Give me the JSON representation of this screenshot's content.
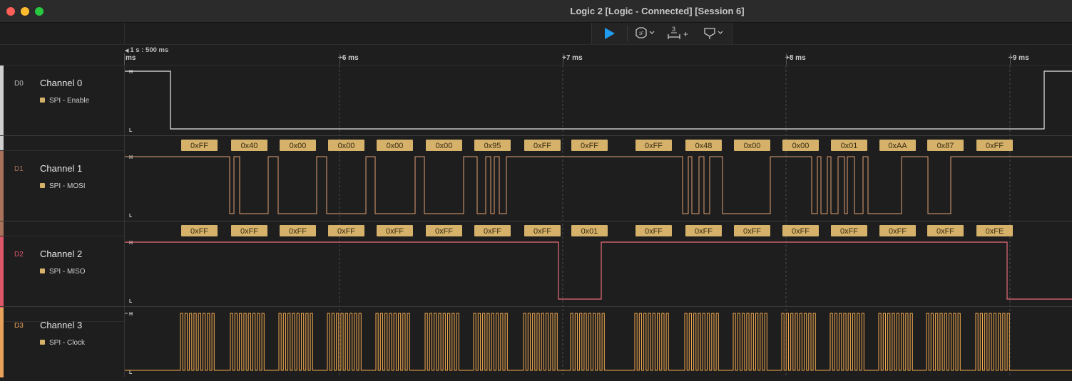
{
  "window": {
    "title": "Logic 2 [Logic - Connected] [Session 6]"
  },
  "toolbar": {
    "play_icon": "play-icon",
    "trigger_icon": "trigger-icon",
    "measure_label": "3",
    "measure_plus": "+",
    "marker_icon": "marker-icon"
  },
  "ruler": {
    "scale": "1 s : 500 ms",
    "unit": "ms",
    "ticks": [
      "+6 ms",
      "+7 ms",
      "+8 ms",
      "+9 ms"
    ]
  },
  "channels": [
    {
      "id": "D0",
      "name": "Channel 0",
      "analyzer": "SPI - Enable",
      "color": "#cfcfcf"
    },
    {
      "id": "D1",
      "name": "Channel 1",
      "analyzer": "SPI - MOSI",
      "color": "#a8735a"
    },
    {
      "id": "D2",
      "name": "Channel 2",
      "analyzer": "SPI - MISO",
      "color": "#e0566a"
    },
    {
      "id": "D3",
      "name": "Channel 3",
      "analyzer": "SPI - Clock",
      "color": "#e8a25a"
    }
  ],
  "level_labels": {
    "high": "H",
    "low": "L"
  },
  "mosi_bytes": [
    "0xFF",
    "0x40",
    "0x00",
    "0x00",
    "0x00",
    "0x00",
    "0x95",
    "0xFF",
    "0xFF",
    "0xFF",
    "0x48",
    "0x00",
    "0x00",
    "0x01",
    "0xAA",
    "0x87",
    "0xFF"
  ],
  "miso_bytes": [
    "0xFF",
    "0xFF",
    "0xFF",
    "0xFF",
    "0xFF",
    "0xFF",
    "0xFF",
    "0xFF",
    "0x01",
    "0xFF",
    "0xFF",
    "0xFF",
    "0xFF",
    "0xFF",
    "0xFF",
    "0xFF",
    "0xFE"
  ],
  "colors": {
    "annotation_fill": "#d5b16a",
    "annotation_text": "#3a2c12",
    "enable_wave": "#e8e8e8",
    "mosi_wave": "#e0a070",
    "miso_wave": "#ea6d7a",
    "clock_wave": "#f0a84e",
    "accent_play": "#1f9bef"
  }
}
